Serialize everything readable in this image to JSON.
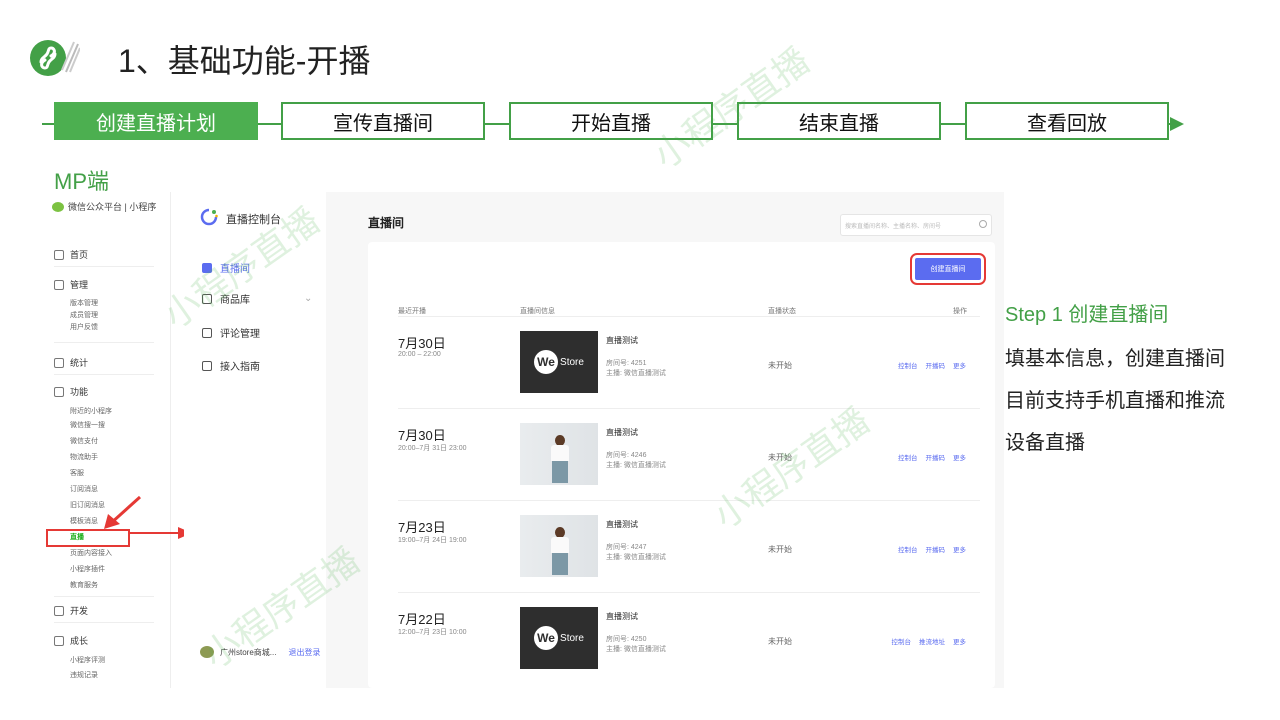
{
  "slide": {
    "title": "1、基础功能-开播",
    "mp_label": "MP端",
    "watermark": "小程序直播"
  },
  "flow": {
    "steps": [
      {
        "label": "创建直播计划",
        "active": true
      },
      {
        "label": "宣传直播间",
        "active": false
      },
      {
        "label": "开始直播",
        "active": false
      },
      {
        "label": "结束直播",
        "active": false
      },
      {
        "label": "查看回放",
        "active": false
      }
    ]
  },
  "wechat_admin": {
    "topbar": "微信公众平台 | 小程序",
    "sections": {
      "home": "首页",
      "manage": "管理",
      "stats": "统计",
      "features": "功能",
      "dev": "开发",
      "growth": "成长"
    },
    "manage_items": [
      "版本管理",
      "成员管理",
      "用户反馈"
    ],
    "feature_items": [
      "附近的小程序",
      "微信搜一搜",
      "微信支付",
      "物流助手",
      "客服",
      "订阅消息",
      "旧订阅消息",
      "模板消息",
      "直播",
      "页面内容接入",
      "小程序插件",
      "教育服务"
    ],
    "growth_items": [
      "小程序评测",
      "违规记录"
    ]
  },
  "live_console": {
    "title": "直播控制台",
    "menu": [
      "直播间",
      "商品库",
      "评论管理",
      "接入指南"
    ],
    "user": "广州store商城...",
    "logout": "退出登录"
  },
  "main": {
    "title": "直播间",
    "search_placeholder": "搜索直播间名称、主播名称、房间号",
    "create_button": "创建直播间",
    "columns": [
      "最近开播",
      "直播间信息",
      "直播状态",
      "操作"
    ],
    "rows": [
      {
        "date": "7月30日",
        "time": "20:00 – 22:00",
        "cover": "westore",
        "name": "直播测试",
        "room": "房间号:   4251",
        "anchor": "主播:     微信直播测试",
        "status": "未开始",
        "ops": [
          "控制台",
          "开播码",
          "更多"
        ]
      },
      {
        "date": "7月30日",
        "time": "20:00–7月 31日 23:00",
        "cover": "photo",
        "name": "直播测试",
        "room": "房间号:   4246",
        "anchor": "主播:     微信直播测试",
        "status": "未开始",
        "ops": [
          "控制台",
          "开播码",
          "更多"
        ]
      },
      {
        "date": "7月23日",
        "time": "19:00–7月 24日 19:00",
        "cover": "photo",
        "name": "直播测试",
        "room": "房间号:   4247",
        "anchor": "主播:     微信直播测试",
        "status": "未开始",
        "ops": [
          "控制台",
          "开播码",
          "更多"
        ]
      },
      {
        "date": "7月22日",
        "time": "12:00–7月 23日 10:00",
        "cover": "westore",
        "name": "直播测试",
        "room": "房间号:   4250",
        "anchor": "主播:     微信直播测试",
        "status": "未开始",
        "ops": [
          "控制台",
          "推流地址",
          "更多"
        ]
      }
    ],
    "cover_text": {
      "we": "We",
      "store": "Store"
    }
  },
  "step_info": {
    "title": "Step 1 创建直播间",
    "lines": [
      "填基本信息，创建直播间",
      "目前支持手机直播和推流",
      "设备直播"
    ]
  },
  "colors": {
    "brand_green": "#43a047",
    "accent": "#5b6cf0",
    "highlight": "#e53935"
  }
}
